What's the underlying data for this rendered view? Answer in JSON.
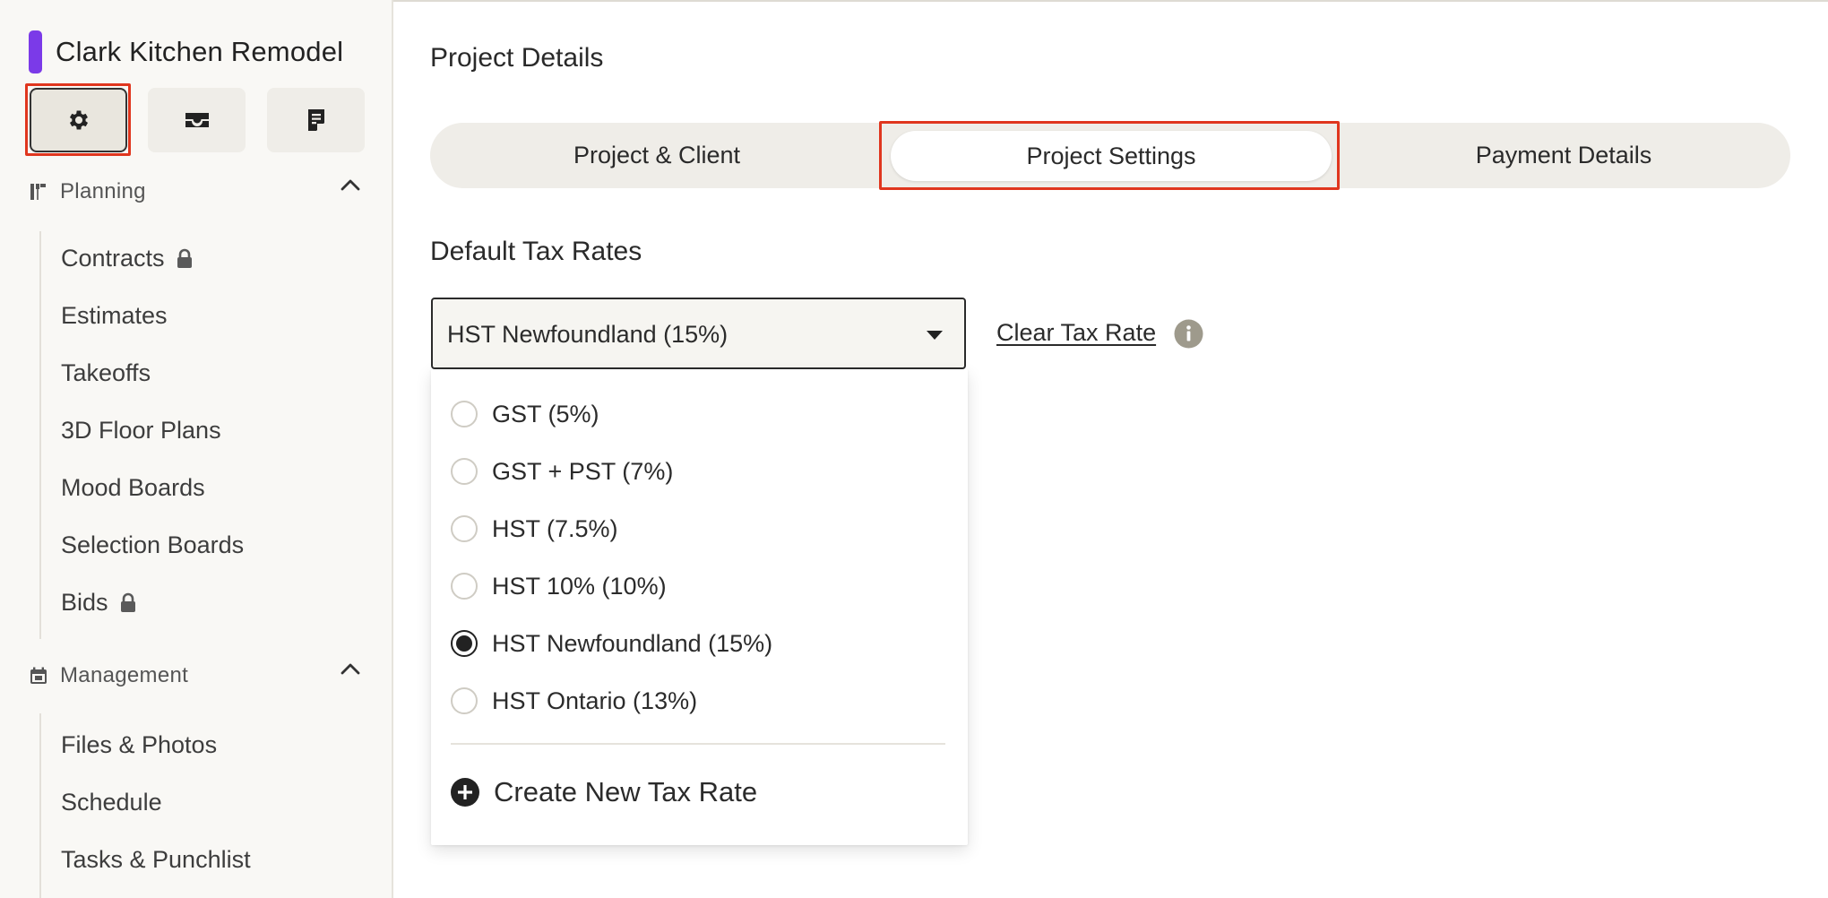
{
  "project": {
    "title": "Clark Kitchen Remodel",
    "accent_color": "#7b3ae8"
  },
  "toolbar": {
    "buttons": [
      {
        "icon": "gear-icon",
        "selected": true
      },
      {
        "icon": "inbox-icon"
      },
      {
        "icon": "notes-icon"
      }
    ]
  },
  "sidebar": {
    "planning": {
      "label": "Planning",
      "items": [
        "Contracts",
        "Estimates",
        "Takeoffs",
        "3D Floor Plans",
        "Mood Boards",
        "Selection Boards",
        "Bids"
      ],
      "locked": [
        "Contracts",
        "Bids"
      ]
    },
    "management": {
      "label": "Management",
      "items": [
        "Files & Photos",
        "Schedule",
        "Tasks & Punchlist"
      ]
    }
  },
  "page": {
    "title": "Project Details"
  },
  "tabs": [
    {
      "label": "Project & Client"
    },
    {
      "label": "Project Settings",
      "active": true
    },
    {
      "label": "Payment Details"
    }
  ],
  "tax": {
    "section_title": "Default Tax Rates",
    "selected": "HST Newfoundland (15%)",
    "clear_label": "Clear Tax Rate",
    "options": [
      {
        "label": "GST (5%)",
        "checked": false
      },
      {
        "label": "GST + PST (7%)",
        "checked": false
      },
      {
        "label": "HST (7.5%)",
        "checked": false
      },
      {
        "label": "HST 10% (10%)",
        "checked": false
      },
      {
        "label": "HST Newfoundland (15%)",
        "checked": true
      },
      {
        "label": "HST Ontario (13%)",
        "checked": false
      }
    ],
    "create_label": "Create New Tax Rate"
  },
  "colors": {
    "highlight": "#e0361e",
    "surface": "#efede8"
  }
}
